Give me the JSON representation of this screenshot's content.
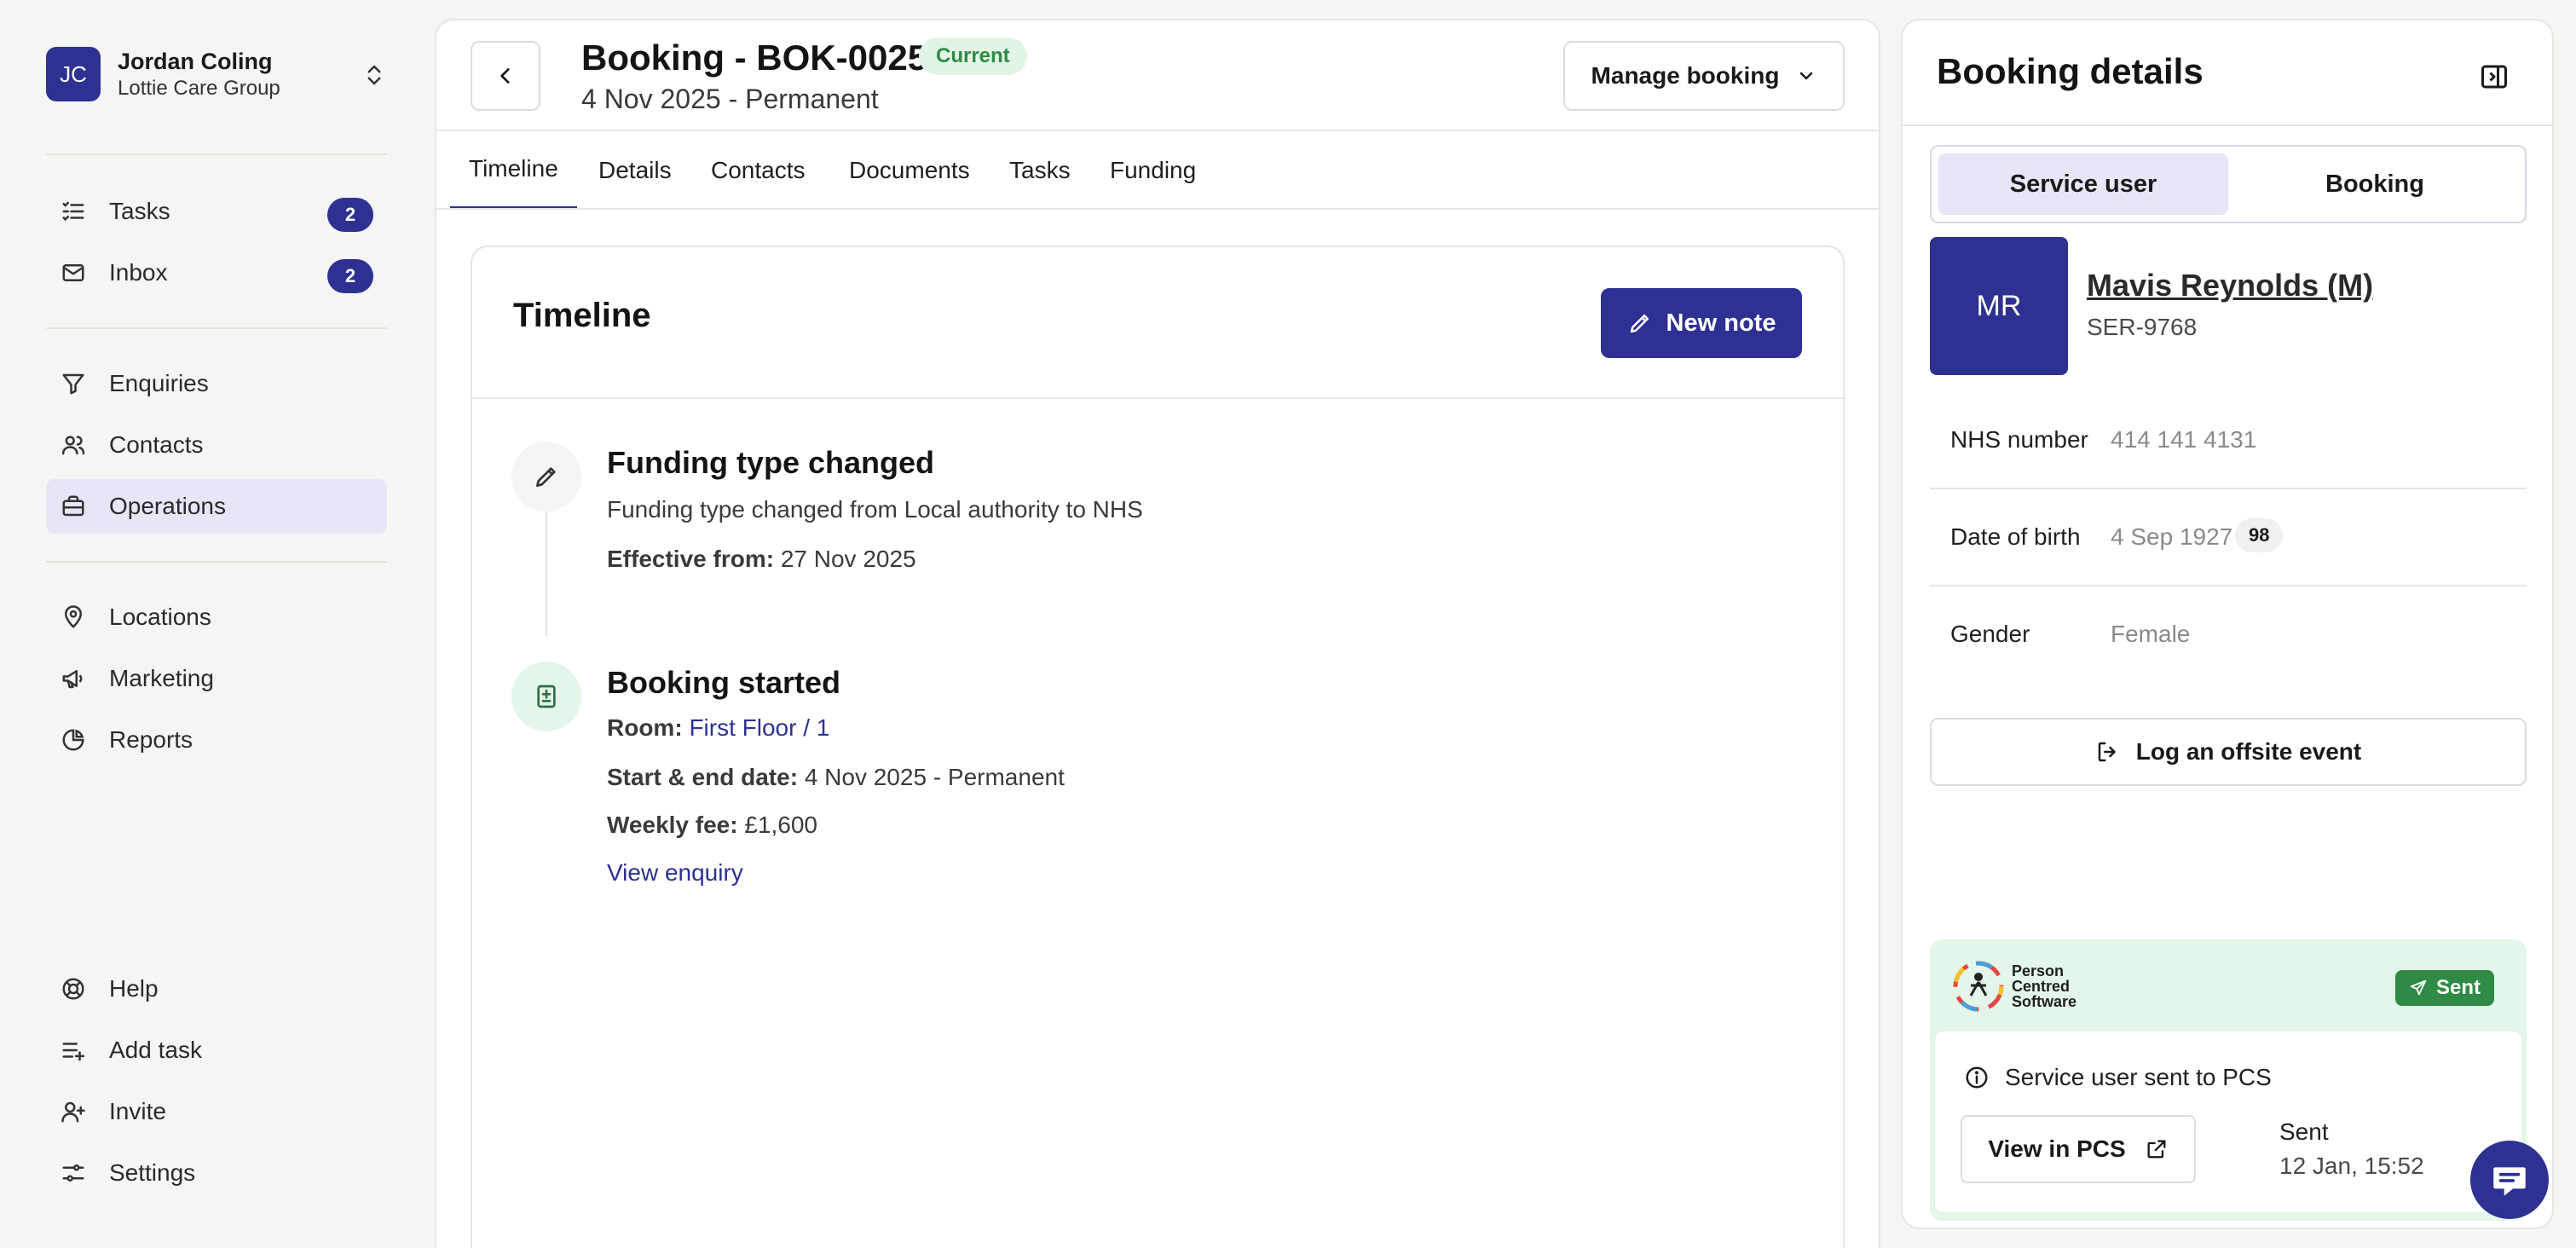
{
  "org": {
    "initials": "JC",
    "user_name": "Jordan Coling",
    "org_name": "Lottie Care Group"
  },
  "sidebar": {
    "top_items": [
      {
        "label": "Tasks",
        "icon": "tasks-list-icon",
        "badge": "2"
      },
      {
        "label": "Inbox",
        "icon": "mail-icon",
        "badge": "2"
      }
    ],
    "main_items": [
      {
        "label": "Enquiries",
        "icon": "filter-icon"
      },
      {
        "label": "Contacts",
        "icon": "people-icon"
      },
      {
        "label": "Operations",
        "icon": "briefcase-icon",
        "active": true
      }
    ],
    "secondary_items": [
      {
        "label": "Locations",
        "icon": "map-pin-icon"
      },
      {
        "label": "Marketing",
        "icon": "megaphone-icon"
      },
      {
        "label": "Reports",
        "icon": "pie-chart-icon"
      }
    ],
    "bottom_items": [
      {
        "label": "Help",
        "icon": "lifebuoy-icon"
      },
      {
        "label": "Add task",
        "icon": "add-task-icon"
      },
      {
        "label": "Invite",
        "icon": "user-plus-icon"
      },
      {
        "label": "Settings",
        "icon": "sliders-icon"
      }
    ]
  },
  "booking": {
    "title": "Booking - BOK-0025",
    "status": "Current",
    "subtitle": "4 Nov 2025 - Permanent",
    "manage_label": "Manage booking"
  },
  "tabs": [
    "Timeline",
    "Details",
    "Contacts",
    "Documents",
    "Tasks",
    "Funding"
  ],
  "active_tab": "Timeline",
  "timeline": {
    "title": "Timeline",
    "new_note_label": "New note",
    "events": [
      {
        "heading": "Funding type changed",
        "description": "Funding type changed from Local authority to NHS",
        "effective_label": "Effective from:",
        "effective_value": "27 Nov 2025"
      },
      {
        "heading": "Booking started",
        "room_label": "Room:",
        "room_value": "First Floor / 1",
        "dates_label": "Start & end date:",
        "dates_value": "4 Nov 2025 - Permanent",
        "fee_label": "Weekly fee:",
        "fee_value": "£1,600",
        "link_label": "View enquiry"
      }
    ]
  },
  "details_panel": {
    "title": "Booking details",
    "segments": [
      "Service user",
      "Booking"
    ],
    "active_segment": "Service user",
    "service_user": {
      "initials": "MR",
      "name": "Mavis Reynolds (M)",
      "id": "SER-9768"
    },
    "fields": [
      {
        "label": "NHS number",
        "value": "414 141 4131"
      },
      {
        "label": "Date of birth",
        "value": "4 Sep 1927",
        "age": "98"
      },
      {
        "label": "Gender",
        "value": "Female"
      }
    ],
    "offsite_label": "Log an offsite event",
    "pcs": {
      "logo_text": [
        "Person",
        "Centred",
        "Software"
      ],
      "badge": "Sent",
      "message": "Service user sent to PCS",
      "view_label": "View in PCS",
      "sent_label": "Sent",
      "sent_time": "12 Jan, 15:52"
    }
  },
  "colors": {
    "primary": "#2e3192",
    "success": "#2f8a45",
    "success_bg": "#e3f6e9",
    "active_bg": "#e6e6f7"
  }
}
